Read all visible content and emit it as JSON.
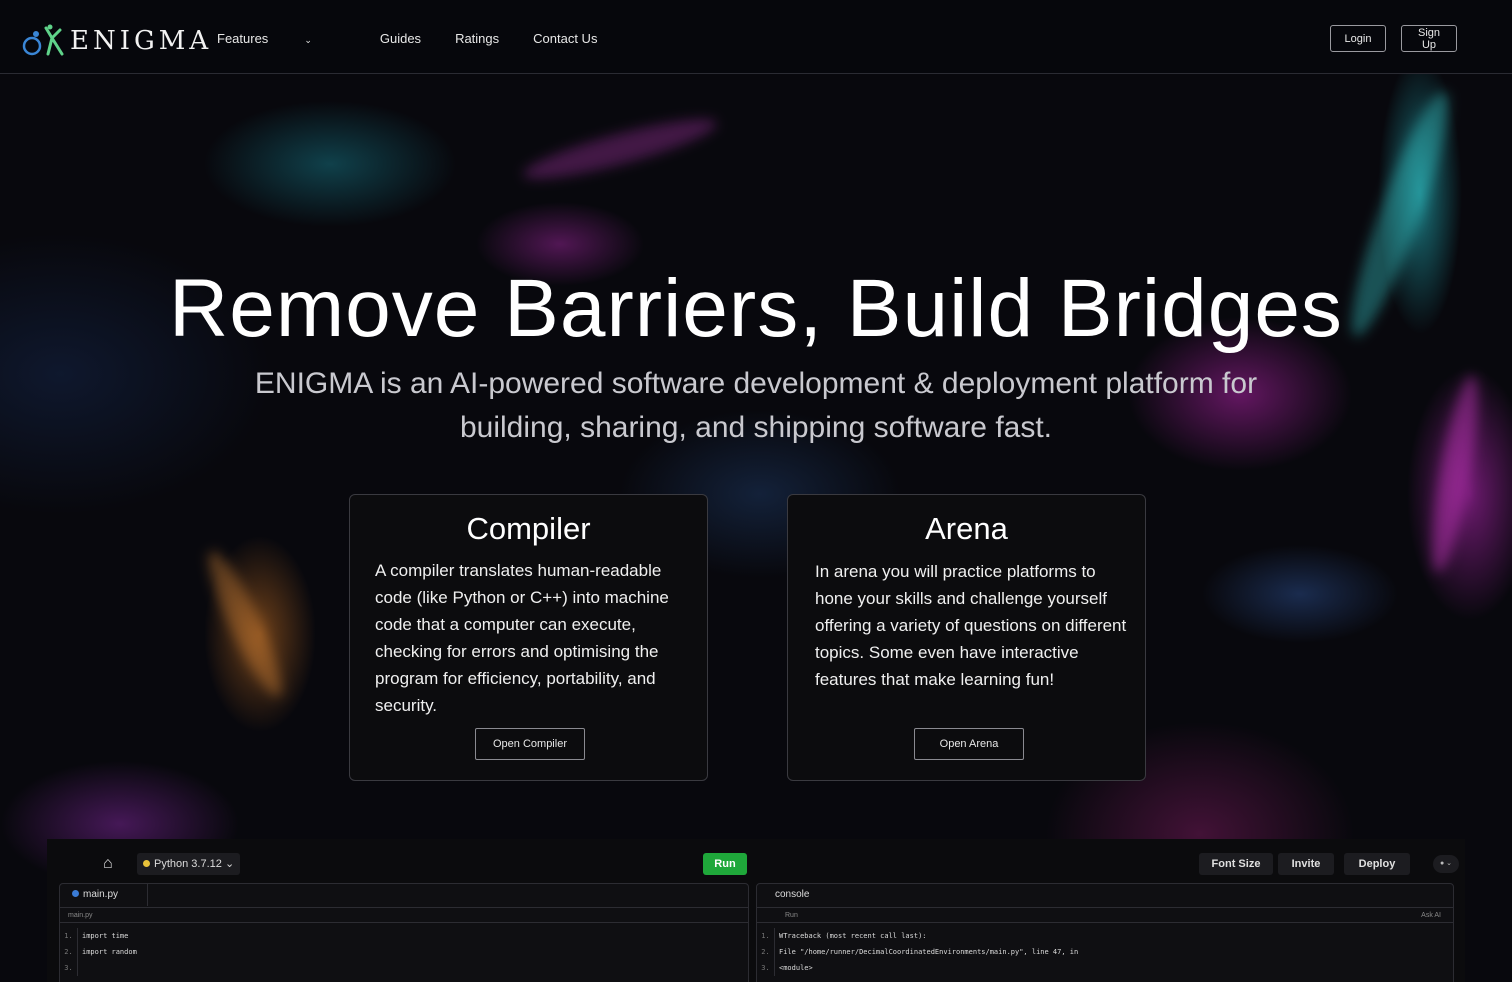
{
  "nav": {
    "brand": "ENIGMA",
    "links": [
      "Features",
      "Guides",
      "Ratings",
      "Contact Us"
    ],
    "login": "Login",
    "signup": "Sign Up"
  },
  "hero": {
    "title": "Remove Barriers, Build Bridges",
    "subtitle": "ENIGMA is an AI-powered software development & deployment platform for building, sharing, and shipping software fast."
  },
  "cards": [
    {
      "title": "Compiler",
      "body": "A compiler translates human-readable code (like Python or C++) into machine code that a computer can execute, checking for errors and optimising the program for efficiency, portability, and security.",
      "button": "Open Compiler"
    },
    {
      "title": "Arena",
      "body": "In arena you will practice platforms to hone your skills and challenge yourself offering a variety of questions on different topics. Some even have interactive features that make learning fun!",
      "button": "Open Arena"
    }
  ],
  "ide": {
    "language": "Python 3.7.12",
    "run": "Run",
    "font_size": "Font Size",
    "invite": "Invite",
    "deploy": "Deploy",
    "editor": {
      "tab": "main.py",
      "file": "main.py",
      "lines": [
        {
          "n": "1.",
          "text": "import time"
        },
        {
          "n": "2.",
          "text": "import random"
        },
        {
          "n": "3.",
          "text": ""
        }
      ]
    },
    "console": {
      "title": "console",
      "left_label": "Run",
      "right_label": "Ask AI",
      "lines": [
        {
          "n": "1.",
          "text": "WTraceback (most recent call last):"
        },
        {
          "n": "2.",
          "text": "  File \"/home/runner/DecimalCoordinatedEnvironments/main.py\", line 47, in"
        },
        {
          "n": "3.",
          "text": "<module>"
        }
      ]
    }
  },
  "colors": {
    "run_green": "#1fa83a",
    "card_bg": "#0c0c0e",
    "nav_bg": "#06070c"
  }
}
